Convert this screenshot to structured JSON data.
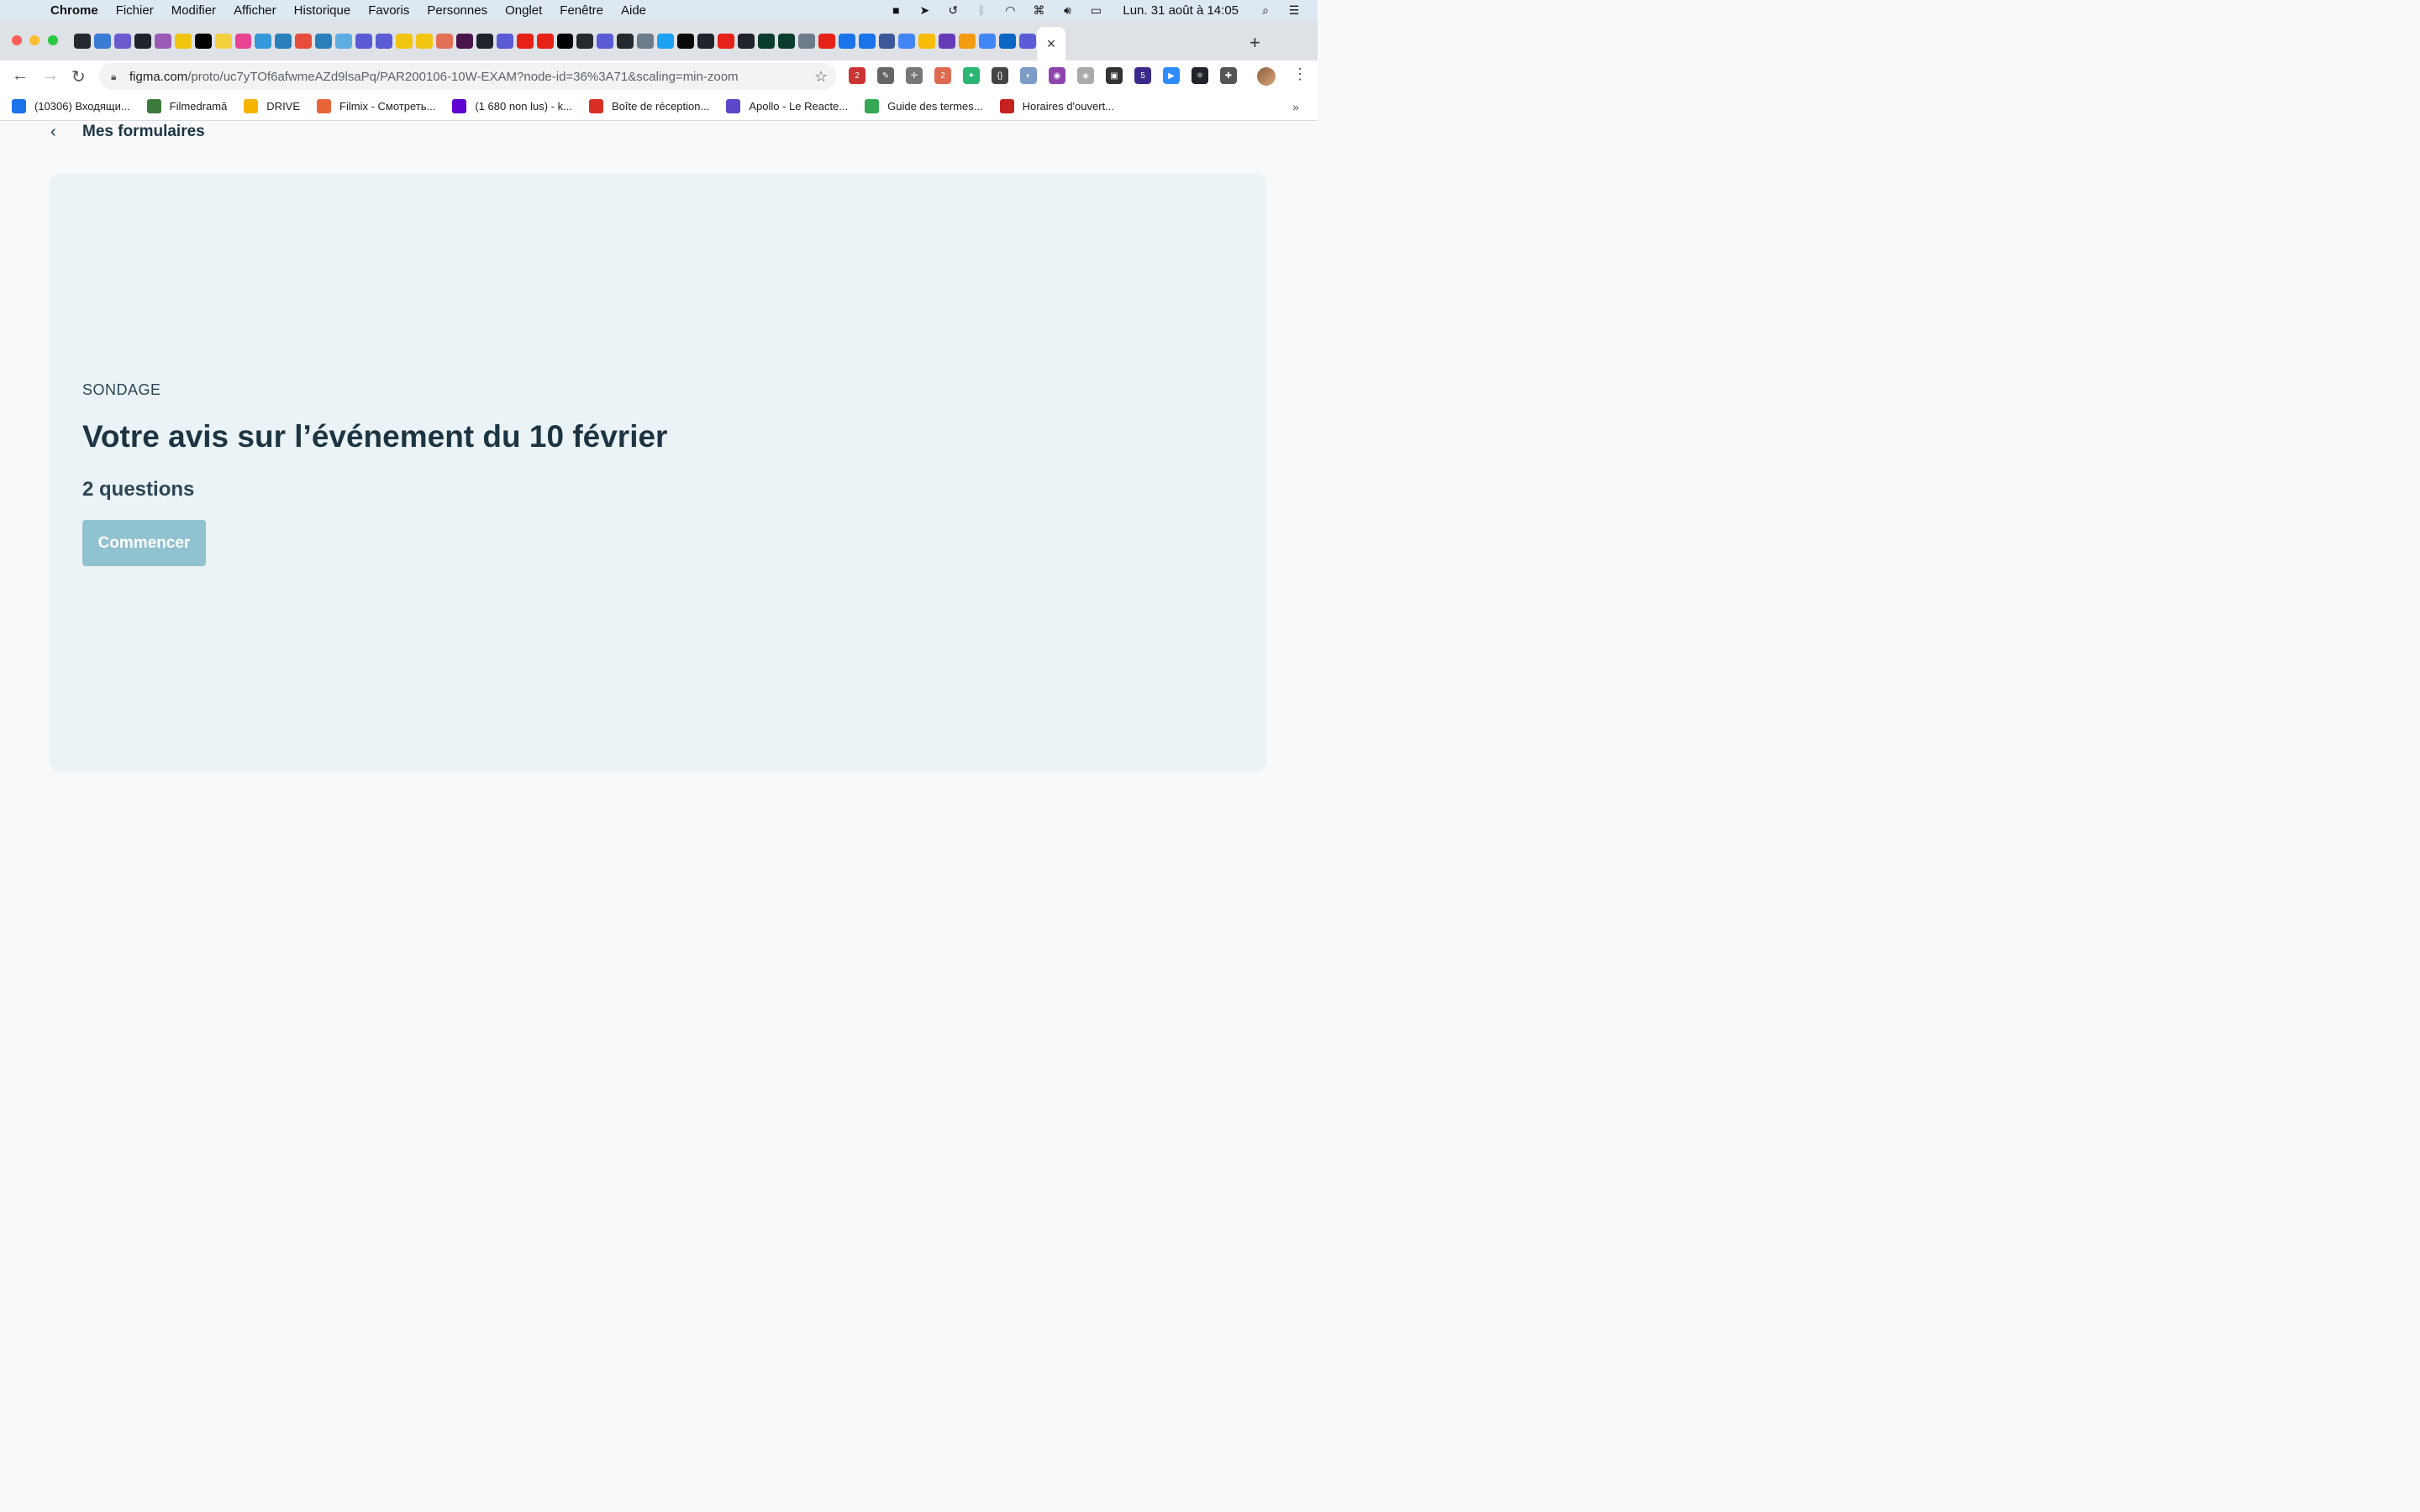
{
  "menubar": {
    "app": "Chrome",
    "items": [
      "Fichier",
      "Modifier",
      "Afficher",
      "Historique",
      "Favoris",
      "Personnes",
      "Onglet",
      "Fenêtre",
      "Aide"
    ],
    "clock": "Lun. 31 août à 14:05"
  },
  "browser": {
    "url_host": "figma.com",
    "url_path": "/proto/uc7yTOf6afwmeAZd9lsaPq/PAR200106-10W-EXAM?node-id=36%3A71&scaling=min-zoom",
    "active_tab_close": "×",
    "new_tab": "+",
    "extension_badges": {
      "abp": "2",
      "second": "2",
      "grad": "5"
    }
  },
  "bookmarks": [
    {
      "label": "(10306) Входящи...",
      "color": "#1a73e8"
    },
    {
      "label": "Filmedramă",
      "color": "#3c7a3c"
    },
    {
      "label": "DRIVE",
      "color": "#f4b400"
    },
    {
      "label": "Filmix - Смотреть...",
      "color": "#e8653a"
    },
    {
      "label": "(1 680 non lus) - k...",
      "color": "#5f01d1"
    },
    {
      "label": "Boîte de réception...",
      "color": "#d93025"
    },
    {
      "label": "Apollo - Le Reacte...",
      "color": "#5a48c9"
    },
    {
      "label": "Guide des termes...",
      "color": "#34a853"
    },
    {
      "label": "Horaires d'ouvert...",
      "color": "#c5221f"
    }
  ],
  "page": {
    "back_label": "Mes formulaires",
    "kicker": "SONDAGE",
    "title": "Votre avis sur l’événement du 10 février",
    "question_count": "2 questions",
    "start_button": "Commencer"
  }
}
